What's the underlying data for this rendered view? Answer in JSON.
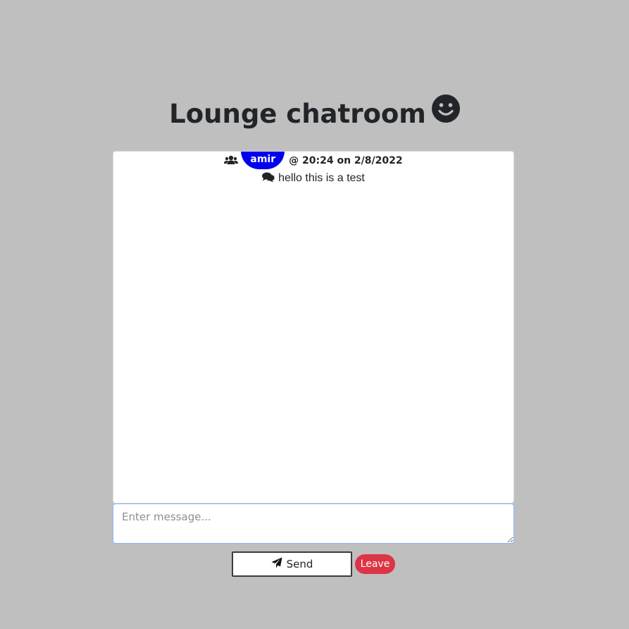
{
  "room": {
    "title": "Lounge chatroom",
    "title_icon": "smiley-icon"
  },
  "messages": [
    {
      "user": "amir",
      "timestamp": "@ 20:24 on 2/8/2022",
      "text": "hello this is a test",
      "user_icon": "users-icon",
      "text_icon": "comments-icon"
    }
  ],
  "composer": {
    "placeholder": "Enter message...",
    "value": ""
  },
  "buttons": {
    "send_label": "Send",
    "send_icon": "paper-plane-icon",
    "leave_label": "Leave"
  },
  "colors": {
    "background": "#bfbfbf",
    "username_badge": "#0000ee",
    "leave_button": "#dc3545",
    "input_border_focus": "#86b7fe"
  }
}
